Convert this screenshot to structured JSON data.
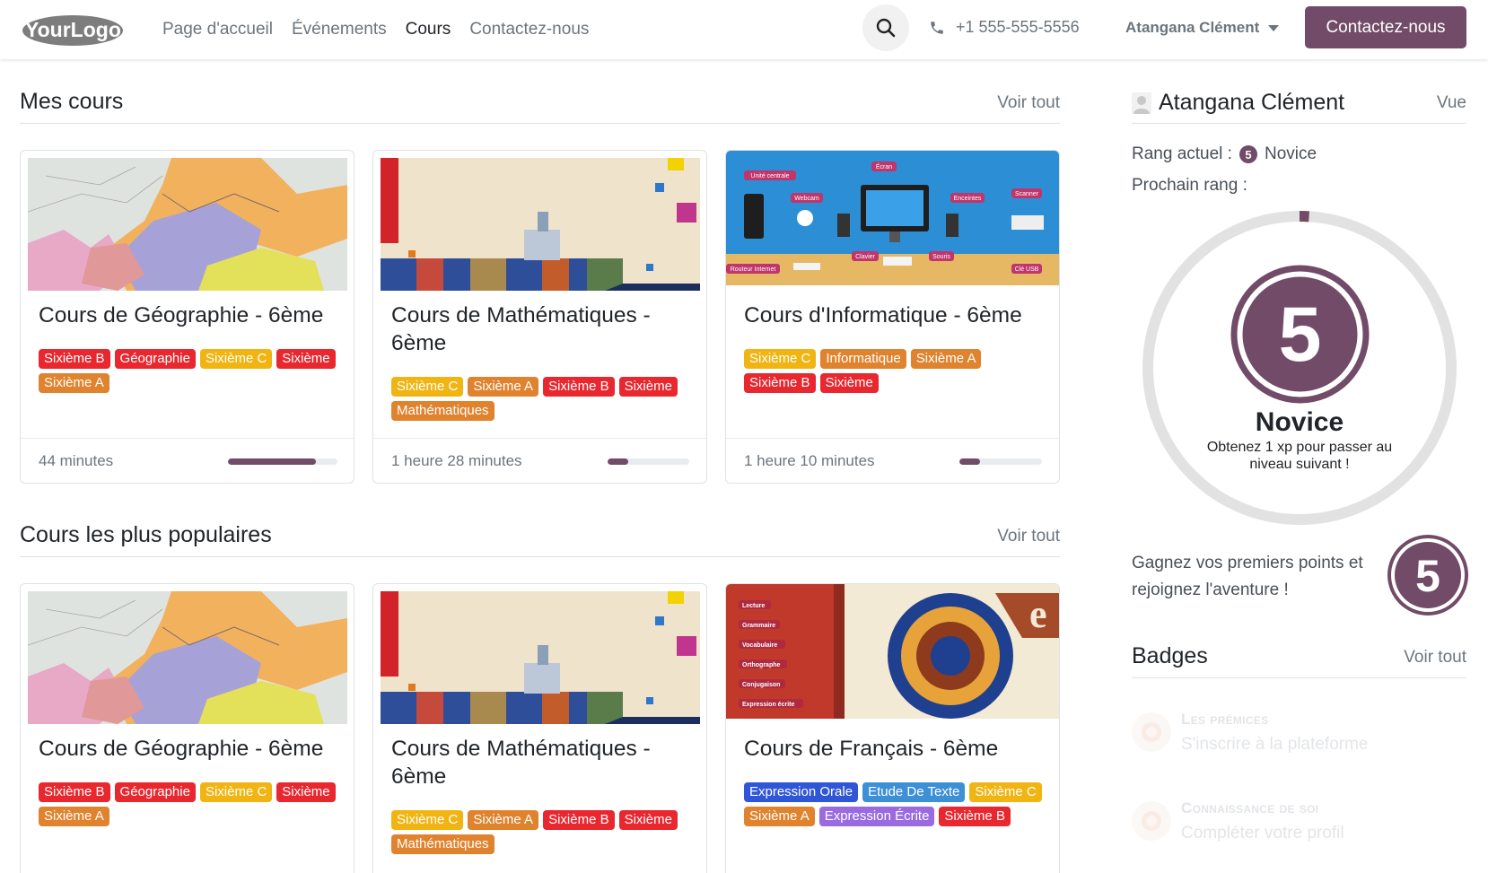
{
  "nav": {
    "logo": "YourLogo",
    "links": [
      "Page d'accueil",
      "Événements",
      "Cours",
      "Contactez-nous"
    ],
    "active_link": "Cours",
    "phone": "+1 555-555-5556",
    "user": "Atangana Clément",
    "cta": "Contactez-nous",
    "icons": {
      "search": "search-icon",
      "phone": "phone-icon",
      "caret": "chevron-down-icon"
    }
  },
  "colors": {
    "brand": "#714b67",
    "tag_red": "#e8272f",
    "tag_yellow": "#f0b512",
    "tag_orange": "#e0832e",
    "tag_blue": "#2f56d6",
    "tag_sky": "#3d8fd6",
    "tag_purple": "#9a6be0"
  },
  "my_courses": {
    "title": "Mes cours",
    "see_all": "Voir tout",
    "cards": [
      {
        "title": "Cours de Géographie - 6ème",
        "image": "map",
        "tags": [
          {
            "label": "Sixième B",
            "color": "red"
          },
          {
            "label": "Géographie",
            "color": "red"
          },
          {
            "label": "Sixième C",
            "color": "yellow"
          },
          {
            "label": "Sixième",
            "color": "red"
          },
          {
            "label": "Sixième A",
            "color": "orange"
          }
        ],
        "duration": "44 minutes",
        "progress": 0.8
      },
      {
        "title": "Cours de Mathématiques - 6ème",
        "image": "ship",
        "tags": [
          {
            "label": "Sixième C",
            "color": "yellow"
          },
          {
            "label": "Sixième A",
            "color": "orange"
          },
          {
            "label": "Sixième B",
            "color": "red"
          },
          {
            "label": "Sixième",
            "color": "red"
          },
          {
            "label": "Mathématiques",
            "color": "orange"
          }
        ],
        "duration": "1 heure 28 minutes",
        "progress": 0.25
      },
      {
        "title": "Cours d'Informatique - 6ème",
        "image": "computer",
        "tags": [
          {
            "label": "Sixième C",
            "color": "yellow"
          },
          {
            "label": "Informatique",
            "color": "orange"
          },
          {
            "label": "Sixième A",
            "color": "orange"
          },
          {
            "label": "Sixième B",
            "color": "red"
          },
          {
            "label": "Sixième",
            "color": "red"
          }
        ],
        "duration": "1 heure 10 minutes",
        "progress": 0.25
      }
    ]
  },
  "popular_courses": {
    "title": "Cours les plus populaires",
    "see_all": "Voir tout",
    "cards": [
      {
        "title": "Cours de Géographie - 6ème",
        "image": "map",
        "tags": [
          {
            "label": "Sixième B",
            "color": "red"
          },
          {
            "label": "Géographie",
            "color": "red"
          },
          {
            "label": "Sixième C",
            "color": "yellow"
          },
          {
            "label": "Sixième",
            "color": "red"
          },
          {
            "label": "Sixième A",
            "color": "orange"
          }
        ]
      },
      {
        "title": "Cours de Mathématiques - 6ème",
        "image": "ship",
        "tags": [
          {
            "label": "Sixième C",
            "color": "yellow"
          },
          {
            "label": "Sixième A",
            "color": "orange"
          },
          {
            "label": "Sixième B",
            "color": "red"
          },
          {
            "label": "Sixième",
            "color": "red"
          },
          {
            "label": "Mathématiques",
            "color": "orange"
          }
        ]
      },
      {
        "title": "Cours de Français - 6ème",
        "image": "french",
        "tags": [
          {
            "label": "Expression Orale",
            "color": "blue"
          },
          {
            "label": "Etude De Texte",
            "color": "sky"
          },
          {
            "label": "Sixième C",
            "color": "yellow"
          },
          {
            "label": "Sixième A",
            "color": "orange"
          },
          {
            "label": "Expression Écrite",
            "color": "purple"
          },
          {
            "label": "Sixième B",
            "color": "red"
          }
        ]
      }
    ]
  },
  "image_labels": {
    "computer": [
      "Unité centrale",
      "Webcam",
      "Écran",
      "Enceintes",
      "Scanner",
      "Clavier",
      "Souris",
      "Routeur Internet",
      "Clé USB"
    ],
    "french": [
      "Lecture",
      "Grammaire",
      "Vocabulaire",
      "Orthographe",
      "Conjugaison",
      "Expression écrite"
    ],
    "french_letter": "e"
  },
  "profile": {
    "name": "Atangana Clément",
    "view_link": "Vue",
    "current_rank_label": "Rang actuel :",
    "current_rank_level": "5",
    "current_rank_name": "Novice",
    "next_rank_label": "Prochain rang :",
    "rank_badge_number": "5",
    "ring_progress": 0.01,
    "rank_name": "Novice",
    "rank_sub": "Obtenez 1 xp pour passer au niveau suivant !",
    "earn_text": "Gagnez vos premiers points et rejoignez l'aventure !",
    "earn_badge_number": "5"
  },
  "badges": {
    "title": "Badges",
    "see_all": "Voir tout",
    "items": [
      {
        "title": "Les prémices",
        "desc": "S'inscrire à la plateforme"
      },
      {
        "title": "Connaissance de soi",
        "desc": "Compléter votre profil"
      }
    ]
  }
}
